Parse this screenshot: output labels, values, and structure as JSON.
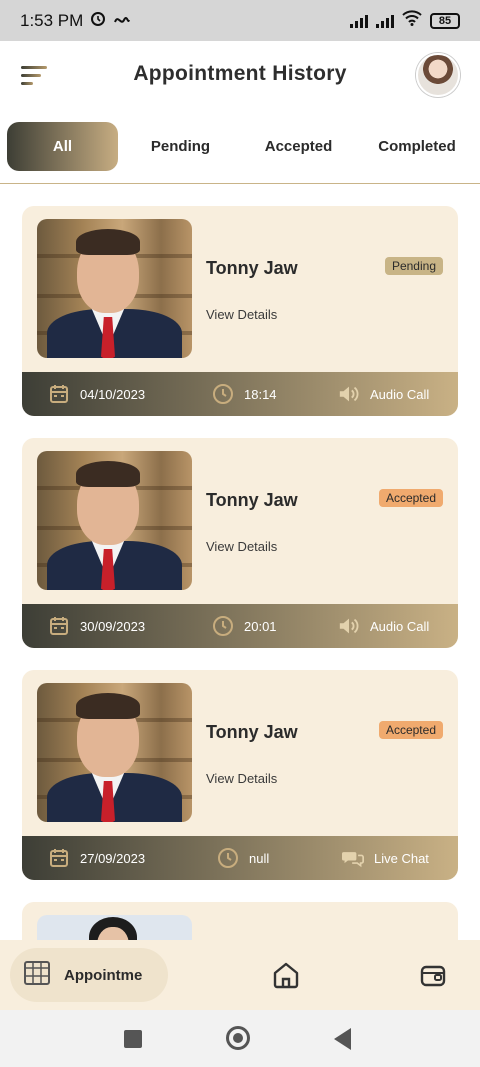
{
  "status_bar": {
    "time": "1:53 PM",
    "battery": "85"
  },
  "header": {
    "title": "Appointment History"
  },
  "tabs": [
    {
      "label": "All",
      "active": true
    },
    {
      "label": "Pending",
      "active": false
    },
    {
      "label": "Accepted",
      "active": false
    },
    {
      "label": "Completed",
      "active": false
    }
  ],
  "appointments": [
    {
      "name": "Tonny Jaw",
      "status": "Pending",
      "link": "View Details",
      "date": "04/10/2023",
      "time": "18:14",
      "type": "Audio Call",
      "type_icon": "speaker-icon"
    },
    {
      "name": "Tonny Jaw",
      "status": "Accepted",
      "link": "View Details",
      "date": "30/09/2023",
      "time": "20:01",
      "type": "Audio Call",
      "type_icon": "speaker-icon"
    },
    {
      "name": "Tonny Jaw",
      "status": "Accepted",
      "link": "View Details",
      "date": "27/09/2023",
      "time": "null",
      "type": "Live Chat",
      "type_icon": "chat-bubbles-icon"
    }
  ],
  "bottom_nav": {
    "appointments_label": "Appointme"
  },
  "colors": {
    "accent_dark": "#3d3e36",
    "accent_gold": "#c9b185",
    "card_bg": "#f8eedd",
    "pending": "#c8b486",
    "accepted": "#f0aa6e"
  }
}
